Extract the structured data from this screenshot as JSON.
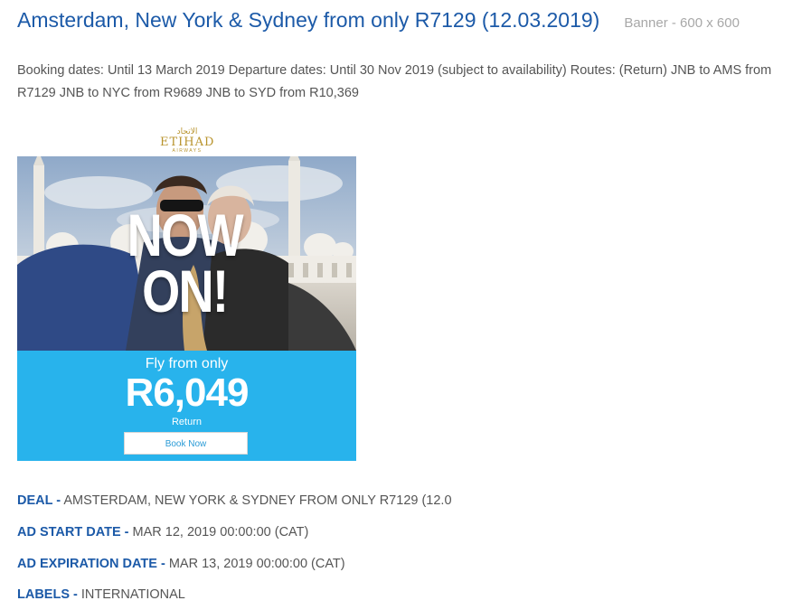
{
  "header": {
    "title": "Amsterdam, New York & Sydney from only R7129 (12.03.2019)",
    "banner_size": "Banner - 600 x 600"
  },
  "description": "Booking dates: Until 13 March 2019 Departure dates: Until 30 Nov 2019 (subject to availability) Routes: (Return) JNB to AMS from R7129 JNB to NYC from R9689 JNB to SYD from R10,369",
  "ad": {
    "logo": {
      "arabic": "الاتحاد",
      "name": "ETIHAD",
      "sub": "AIRWAYS"
    },
    "headline_line1": "NOW",
    "headline_line2": "ON!",
    "promo_label": "Fly from only",
    "price": "R6,049",
    "fare_type": "Return",
    "cta": "Book Now",
    "colors": {
      "panel": "#28b3ec",
      "logo": "#b8932c"
    }
  },
  "details": {
    "deal_key": "DEAL -",
    "deal_value": "AMSTERDAM, NEW YORK & SYDNEY FROM ONLY R7129 (12.0",
    "start_key": "AD START DATE -",
    "start_value": "MAR 12, 2019 00:00:00 (CAT)",
    "expiry_key": "AD EXPIRATION DATE -",
    "expiry_value": "MAR 13, 2019 00:00:00 (CAT)",
    "labels_key": "LABELS -",
    "labels_value": "INTERNATIONAL"
  }
}
